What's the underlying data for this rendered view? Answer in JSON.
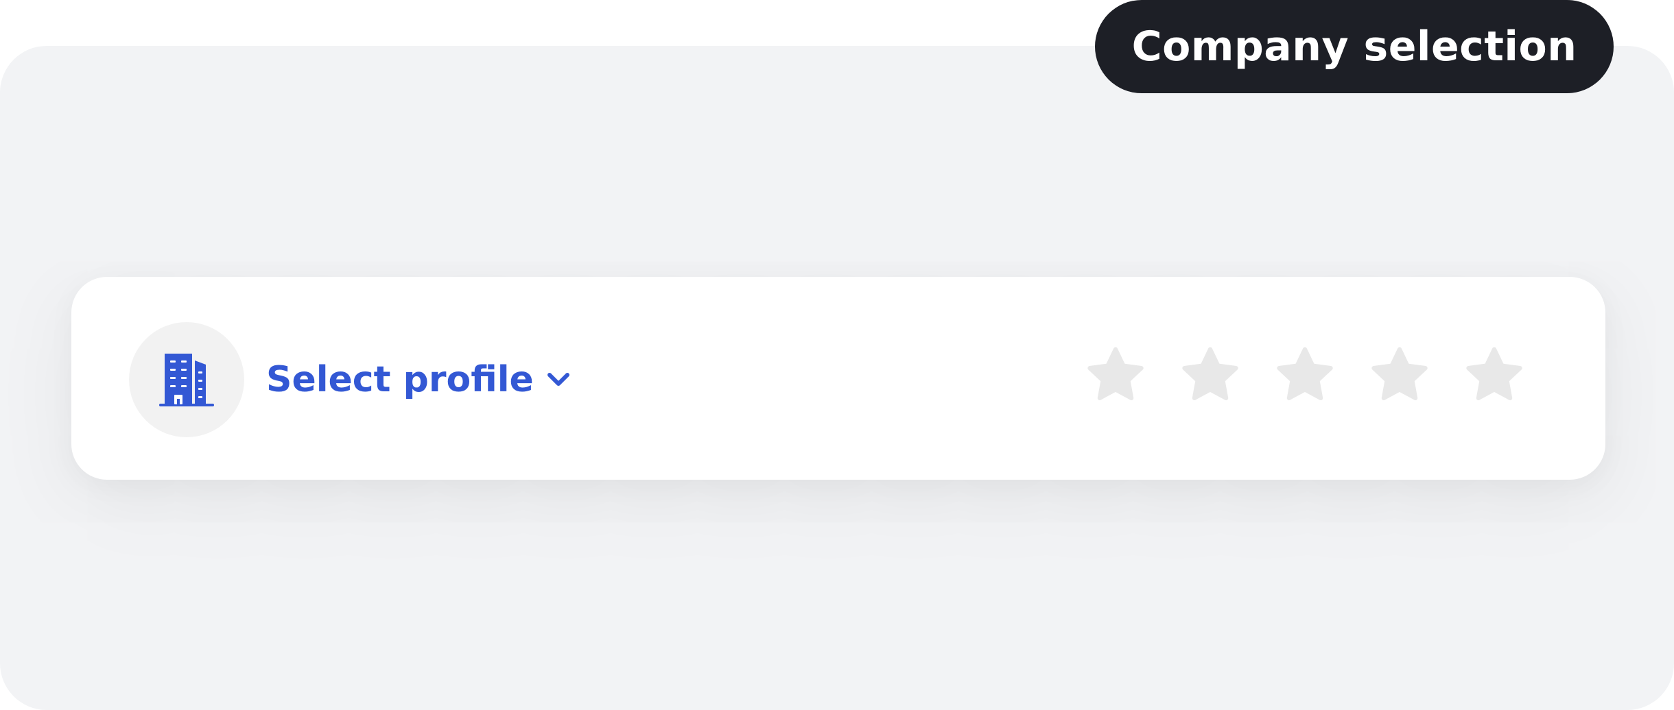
{
  "header": {
    "tag_label": "Company selection"
  },
  "profile": {
    "label": "Select profile",
    "avatar_icon": "building-icon",
    "dropdown_icon": "chevron-down-icon"
  },
  "rating": {
    "value": 0,
    "max": 5,
    "icon": "star-icon"
  },
  "colors": {
    "accent": "#3358d4",
    "tag_background": "#1d1f26",
    "panel_background": "#f2f3f5",
    "star_empty": "#e8e8e8"
  }
}
